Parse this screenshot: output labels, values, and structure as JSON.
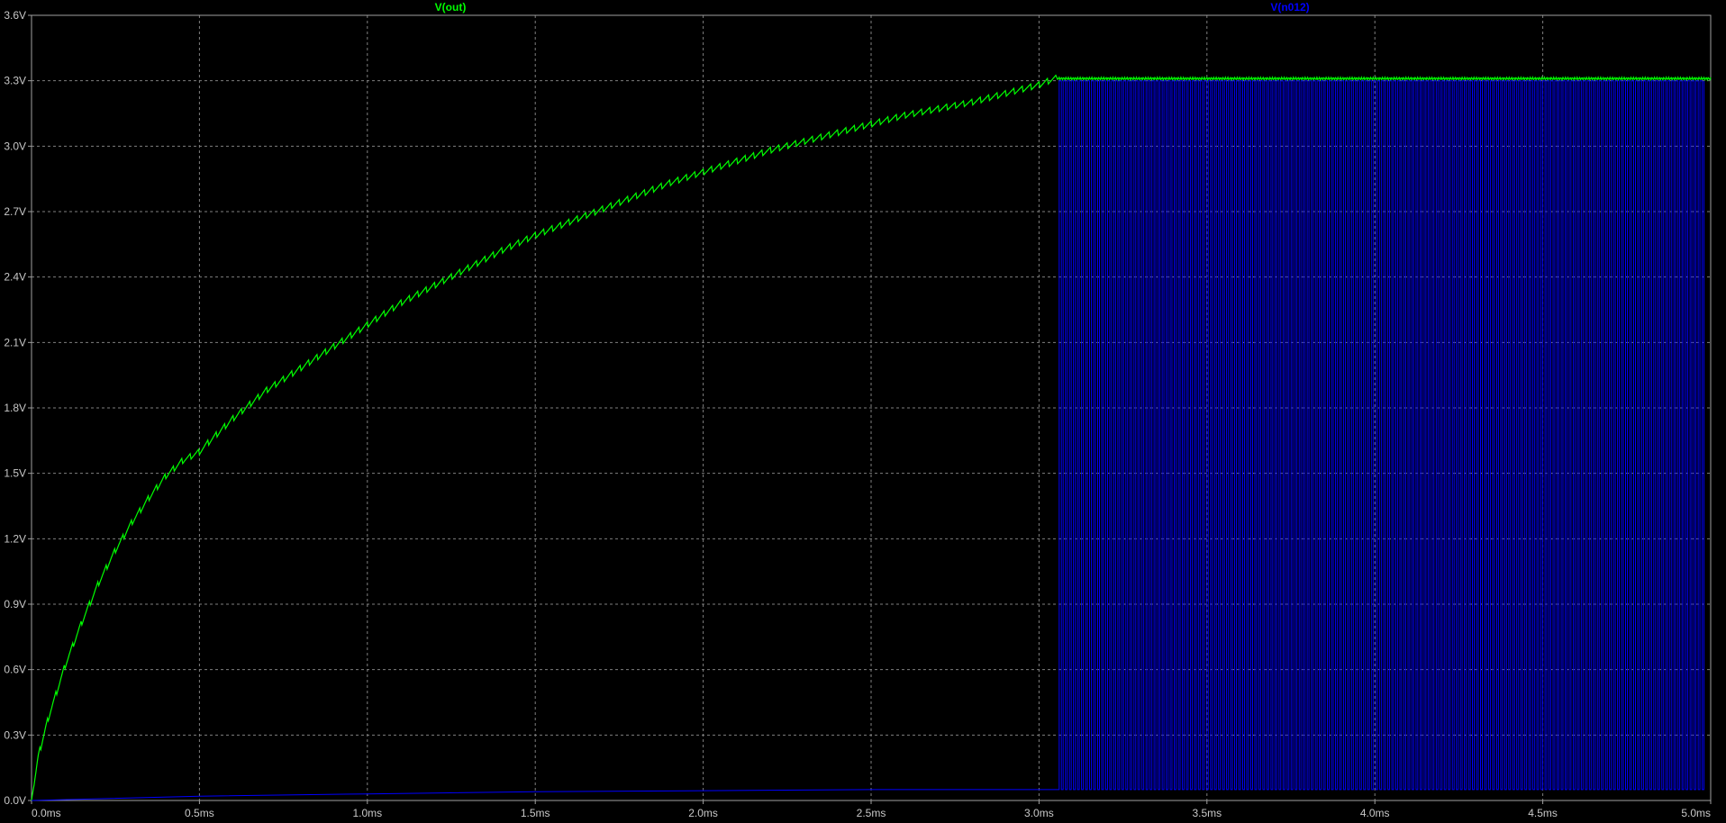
{
  "chart_data": {
    "type": "line",
    "background": "#000000",
    "grid": true,
    "grid_color": "#7f7f7f",
    "axis_color": "#a0a0a0",
    "tick_color": "#c8c8c8",
    "xlim": [
      0,
      5.0
    ],
    "ylim": [
      0,
      3.6
    ],
    "x_ticks": [
      {
        "value": 0.0,
        "label": "0.0ms"
      },
      {
        "value": 0.5,
        "label": "0.5ms"
      },
      {
        "value": 1.0,
        "label": "1.0ms"
      },
      {
        "value": 1.5,
        "label": "1.5ms"
      },
      {
        "value": 2.0,
        "label": "2.0ms"
      },
      {
        "value": 2.5,
        "label": "2.5ms"
      },
      {
        "value": 3.0,
        "label": "3.0ms"
      },
      {
        "value": 3.5,
        "label": "3.5ms"
      },
      {
        "value": 4.0,
        "label": "4.0ms"
      },
      {
        "value": 4.5,
        "label": "4.5ms"
      },
      {
        "value": 5.0,
        "label": "5.0ms"
      }
    ],
    "y_ticks": [
      {
        "value": 0.0,
        "label": "0.0V"
      },
      {
        "value": 0.3,
        "label": "0.3V"
      },
      {
        "value": 0.6,
        "label": "0.6V"
      },
      {
        "value": 0.9,
        "label": "0.9V"
      },
      {
        "value": 1.2,
        "label": "1.2V"
      },
      {
        "value": 1.5,
        "label": "1.5V"
      },
      {
        "value": 1.8,
        "label": "1.8V"
      },
      {
        "value": 2.1,
        "label": "2.1V"
      },
      {
        "value": 2.4,
        "label": "2.4V"
      },
      {
        "value": 2.7,
        "label": "2.7V"
      },
      {
        "value": 3.0,
        "label": "3.0V"
      },
      {
        "value": 3.3,
        "label": "3.3V"
      },
      {
        "value": 3.6,
        "label": "3.6V"
      }
    ],
    "series": [
      {
        "name": "V(out)",
        "color": "#00ff00",
        "x": [
          0.0,
          0.02,
          0.05,
          0.1,
          0.15,
          0.2,
          0.25,
          0.3,
          0.35,
          0.4,
          0.45,
          0.5,
          0.6,
          0.7,
          0.8,
          0.9,
          1.0,
          1.1,
          1.2,
          1.3,
          1.4,
          1.5,
          1.6,
          1.7,
          1.8,
          1.9,
          2.0,
          2.1,
          2.2,
          2.3,
          2.4,
          2.5,
          2.6,
          2.7,
          2.8,
          2.9,
          3.0,
          3.05,
          3.1,
          3.5,
          4.0,
          4.5,
          5.0
        ],
        "values": [
          0.0,
          0.2,
          0.38,
          0.62,
          0.82,
          1.0,
          1.15,
          1.28,
          1.39,
          1.49,
          1.56,
          1.6,
          1.75,
          1.88,
          1.98,
          2.08,
          2.18,
          2.28,
          2.36,
          2.44,
          2.52,
          2.59,
          2.65,
          2.71,
          2.77,
          2.83,
          2.88,
          2.93,
          2.98,
          3.02,
          3.06,
          3.1,
          3.14,
          3.17,
          3.2,
          3.24,
          3.28,
          3.31,
          3.31,
          3.31,
          3.31,
          3.31,
          3.31
        ],
        "ripple_period": 0.025,
        "ripple_amplitude": 0.03,
        "ripple_end": 3.05
      },
      {
        "name": "V(n012)",
        "color": "#0000ff",
        "x": [
          0.0,
          0.5,
          1.0,
          1.5,
          2.0,
          2.5,
          3.0,
          3.06
        ],
        "values": [
          0.0,
          0.02,
          0.03,
          0.04,
          0.045,
          0.05,
          0.05,
          0.05
        ],
        "switching": {
          "start": 3.06,
          "end": 4.98,
          "high": 3.3,
          "low": 0.05,
          "period": 0.012
        }
      }
    ]
  }
}
